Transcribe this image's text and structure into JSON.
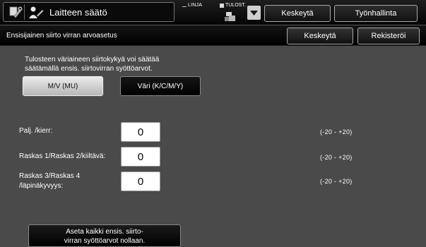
{
  "header": {
    "title": "Laitteen säätö",
    "status_linja": "LINJA",
    "status_tulost": "TULOST.",
    "interrupt_label": "Keskeytä",
    "job_status_label": "Työnhallinta"
  },
  "subheader": {
    "title": "Ensisijainen siirto virran arvoasetus",
    "cancel_label": "Keskeytä",
    "register_label": "Rekisteröi"
  },
  "description": {
    "line1": "Tulosteen väriaineen siirtokykyä voi säätää",
    "line2": "säätämällä ensis. siirtovirran syöttöarvot."
  },
  "mode_toggle": {
    "bw_label": "M/V (MU)",
    "color_label": "Väri (K/C/M/Y)",
    "selected": "bw_label"
  },
  "settings": [
    {
      "label_line1": "Palj. /kierr:",
      "label_line2": "",
      "value": "0",
      "range": "(-20 - +20)"
    },
    {
      "label_line1": "Raskas 1/Raskas 2/kiiltävä:",
      "label_line2": "",
      "value": "0",
      "range": "(-20 - +20)"
    },
    {
      "label_line1": "Raskas 3/Raskas 4",
      "label_line2": "/läpinäkyvyys:",
      "value": "0",
      "range": "(-20 - +20)"
    }
  ],
  "reset": {
    "line1": "Aseta kaikki ensis. siirto-",
    "line2": "virran syöttöarvot nollaan."
  },
  "icons": [
    "wrench-icon",
    "user-adjust-icon",
    "printer-icon",
    "dropdown-arrow-icon"
  ]
}
